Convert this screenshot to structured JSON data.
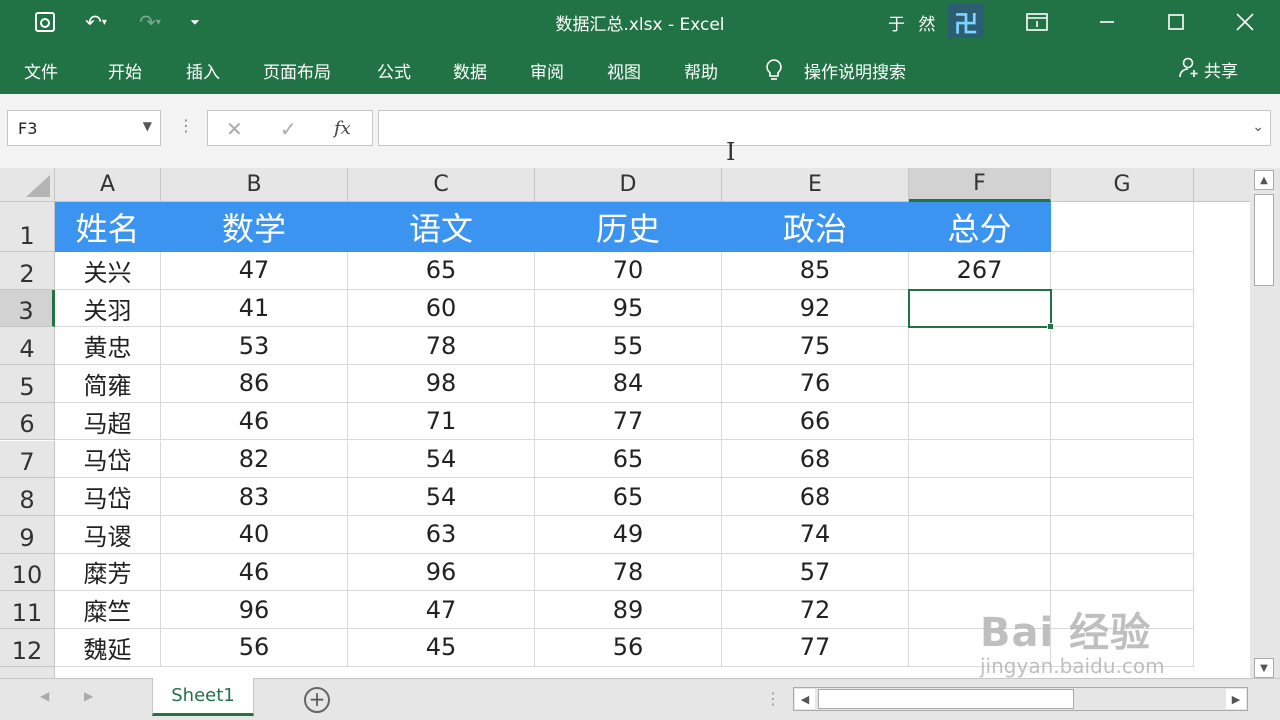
{
  "titlebar": {
    "doc_title": "数据汇总.xlsx  -  Excel",
    "user_name": "于 然",
    "avatar_text": "卍"
  },
  "ribbon": {
    "tabs": [
      "文件",
      "开始",
      "插入",
      "页面布局",
      "公式",
      "数据",
      "审阅",
      "视图",
      "帮助"
    ],
    "tell_me": "操作说明搜索",
    "share": "共享"
  },
  "formula_bar": {
    "name_box": "F3",
    "fx_label": "fx",
    "value": ""
  },
  "grid": {
    "columns": [
      "A",
      "B",
      "C",
      "D",
      "E",
      "F",
      "G"
    ],
    "selected_column": "F",
    "selected_row": "3",
    "row_numbers": [
      "1",
      "2",
      "3",
      "4",
      "5",
      "6",
      "7",
      "8",
      "9",
      "10",
      "11",
      "12"
    ],
    "header_row": [
      "姓名",
      "数学",
      "语文",
      "历史",
      "政治",
      "总分"
    ],
    "rows": [
      [
        "关兴",
        "47",
        "65",
        "70",
        "85",
        "267"
      ],
      [
        "关羽",
        "41",
        "60",
        "95",
        "92",
        ""
      ],
      [
        "黄忠",
        "53",
        "78",
        "55",
        "75",
        ""
      ],
      [
        "简雍",
        "86",
        "98",
        "84",
        "76",
        ""
      ],
      [
        "马超",
        "46",
        "71",
        "77",
        "66",
        ""
      ],
      [
        "马岱",
        "82",
        "54",
        "65",
        "68",
        ""
      ],
      [
        "马岱",
        "83",
        "54",
        "65",
        "68",
        ""
      ],
      [
        "马谡",
        "40",
        "63",
        "49",
        "74",
        ""
      ],
      [
        "糜芳",
        "46",
        "96",
        "78",
        "57",
        ""
      ],
      [
        "糜竺",
        "96",
        "47",
        "89",
        "72",
        ""
      ],
      [
        "魏延",
        "56",
        "45",
        "56",
        "77",
        ""
      ]
    ],
    "header_fill_color": "#3b94f0",
    "accent_color": "#217346"
  },
  "sheets": {
    "active": "Sheet1"
  },
  "watermark": {
    "main": "Bai 经验",
    "url": "jingyan.baidu.com"
  }
}
